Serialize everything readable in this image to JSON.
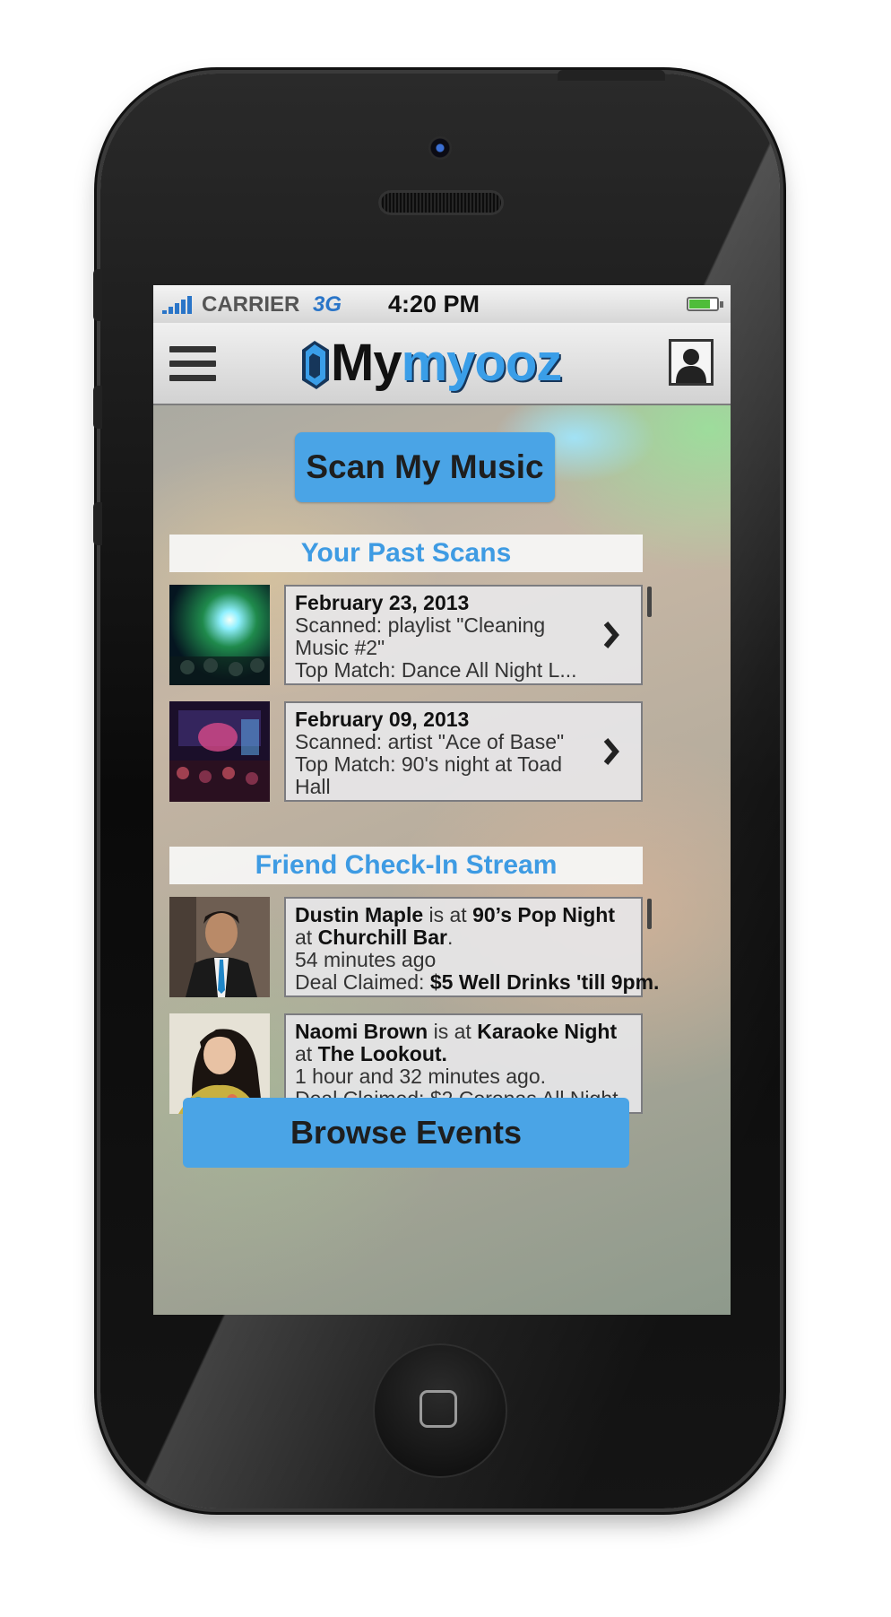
{
  "status_bar": {
    "carrier": "CARRIER",
    "network": "3G",
    "time": "4:20 PM",
    "battery_level": 0.75
  },
  "nav_bar": {
    "logo_my": "My",
    "logo_myooz": "myooz",
    "menu_icon": "hamburger-menu-icon",
    "profile_icon": "user-profile-icon"
  },
  "scan_button_label": "Scan My Music",
  "past_scans": {
    "title": "Your Past Scans",
    "items": [
      {
        "date": "February 23, 2013",
        "scanned": "Scanned:  playlist \"Cleaning Music #2\"",
        "top_match": "Top Match: Dance All Night L..."
      },
      {
        "date": "February 09, 2013",
        "scanned": "Scanned:  artist \"Ace of Base\"",
        "top_match": "Top Match:  90's night at Toad Hall"
      }
    ]
  },
  "friend_stream": {
    "title": "Friend Check-In Stream",
    "items": [
      {
        "name": "Dustin Maple",
        "is_at": "is at",
        "event": "90’s Pop Night",
        "at": "at",
        "venue": "Churchill Bar",
        "venue_suffix": ".",
        "time_ago": "54 minutes ago",
        "deal_label": "Deal Claimed:",
        "deal": "$5 Well Drinks 'till 9pm."
      },
      {
        "name": "Naomi Brown",
        "is_at": "is at",
        "event": "Karaoke Night",
        "at": "at",
        "venue": "The Lookout.",
        "venue_suffix": "",
        "time_ago": "1 hour and 32 minutes ago.",
        "deal_label": "Deal Claimed:",
        "deal": "$2 Coronas All Night."
      }
    ]
  },
  "browse_button_label": "Browse Events",
  "colors": {
    "accent_blue": "#4aa4e6",
    "header_text_blue": "#3e9be3"
  }
}
